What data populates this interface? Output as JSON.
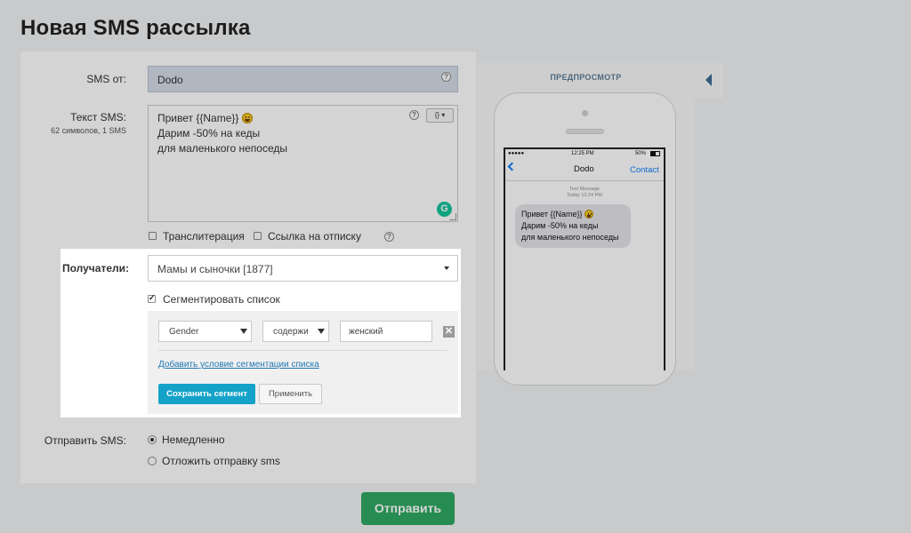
{
  "page": {
    "title": "Новая SMS рассылка"
  },
  "form": {
    "sender": {
      "label": "SMS от:",
      "value": "Dodo"
    },
    "text": {
      "label": "Текст SMS:",
      "counter": "62 символов, 1 SMS",
      "lines": [
        "Привет {{Name}}",
        "Дарим -50% на кеды",
        "для маленького непоседы"
      ],
      "template_button": "{}"
    },
    "options": {
      "transliteration": {
        "label": "Транслитерация",
        "checked": false
      },
      "unsubscribe_link": {
        "label": "Ссылка на отписку",
        "checked": false
      }
    },
    "recipients": {
      "label": "Получатели:",
      "selected": "Мамы и сыночки [1877]"
    },
    "segment": {
      "checkbox_label": "Сегментировать список",
      "checked": true,
      "condition": {
        "field": "Gender",
        "operator": "содержи",
        "value": "женский"
      },
      "add_condition_link": "Добавить условие сегментации списка",
      "save_button": "Сохранить сегмент",
      "apply_button": "Применить"
    },
    "send_time": {
      "label": "Отправить SMS:",
      "options": [
        {
          "label": "Немедленно",
          "selected": true
        },
        {
          "label": "Отложить отправку sms",
          "selected": false
        }
      ]
    },
    "submit_button": "Отправить"
  },
  "preview": {
    "title": "ПРЕДПРОСМОТР",
    "status_bar": {
      "signal": "●●●●● ",
      "time": "12:25 PM",
      "battery": "50%"
    },
    "nav": {
      "title": "Dodo",
      "contact": "Contact"
    },
    "meta": {
      "type": "Text Message",
      "time": "Today 12:24 PM"
    },
    "bubble_lines": [
      "Привет {{Name}}",
      "Дарим -50% на кеды",
      "для маленького непоседы"
    ]
  },
  "colors": {
    "send": "#2ea962",
    "save_segment": "#14a2c8",
    "link": "#1f78b4",
    "ios_blue": "#157efb"
  }
}
